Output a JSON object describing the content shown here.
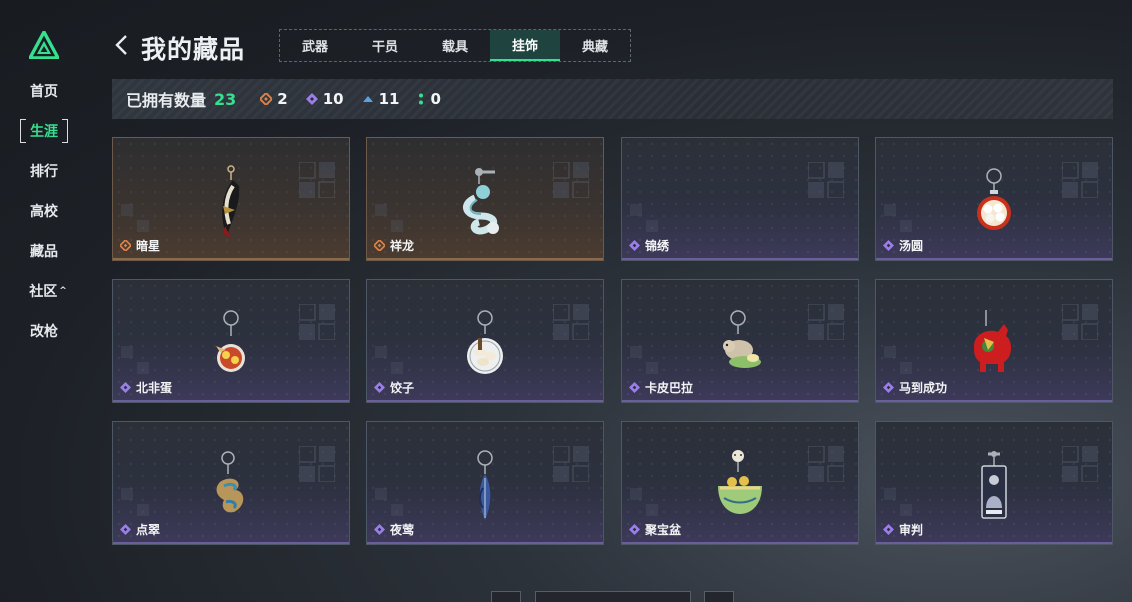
{
  "nav": {
    "items": [
      {
        "label": "首页",
        "active": false
      },
      {
        "label": "生涯",
        "active": true
      },
      {
        "label": "排行",
        "active": false
      },
      {
        "label": "高校",
        "active": false
      },
      {
        "label": "藏品",
        "active": false
      },
      {
        "label": "社区",
        "active": false
      },
      {
        "label": "改枪",
        "active": false
      }
    ],
    "community_caret": "^"
  },
  "header": {
    "title": "我的藏品",
    "tabs": [
      "武器",
      "干员",
      "载具",
      "挂饰",
      "典藏"
    ],
    "active_tab": "挂饰"
  },
  "stats": {
    "label": "已拥有数量",
    "total": "23",
    "counts": [
      {
        "icon": "orange-diamond-icon",
        "color": "#d9804a",
        "value": "2"
      },
      {
        "icon": "purple-diamond-icon",
        "color": "#9b7ee8",
        "value": "10"
      },
      {
        "icon": "blue-chevron-icon",
        "color": "#5aa2e0",
        "value": "11"
      },
      {
        "icon": "green-dots-icon",
        "color": "#35e08e",
        "value": "0"
      }
    ]
  },
  "cards": [
    {
      "name": "暗星",
      "rarity": "orange",
      "icon": "dark-feather-charm-icon"
    },
    {
      "name": "祥龙",
      "rarity": "orange",
      "icon": "jade-dragon-charm-icon"
    },
    {
      "name": "锦绣",
      "rarity": "purple",
      "icon": ""
    },
    {
      "name": "汤圆",
      "rarity": "purple",
      "icon": "tangyuan-bowl-charm-icon"
    },
    {
      "name": "北非蛋",
      "rarity": "purple",
      "icon": "shakshuka-plate-charm-icon"
    },
    {
      "name": "饺子",
      "rarity": "purple",
      "icon": "dumpling-plate-charm-icon"
    },
    {
      "name": "卡皮巴拉",
      "rarity": "purple",
      "icon": "capybara-charm-icon"
    },
    {
      "name": "马到成功",
      "rarity": "purple",
      "icon": "red-horse-charm-icon"
    },
    {
      "name": "点翠",
      "rarity": "purple",
      "icon": "kingfisher-phoenix-charm-icon"
    },
    {
      "name": "夜莺",
      "rarity": "purple",
      "icon": "nightingale-feather-charm-icon"
    },
    {
      "name": "聚宝盆",
      "rarity": "purple",
      "icon": "treasure-bowl-charm-icon"
    },
    {
      "name": "审判",
      "rarity": "purple",
      "icon": "judgement-card-charm-icon"
    }
  ],
  "colors": {
    "accent_green": "#35e08e",
    "rarity_orange": "#d9804a",
    "rarity_purple": "#9b7ee8"
  }
}
